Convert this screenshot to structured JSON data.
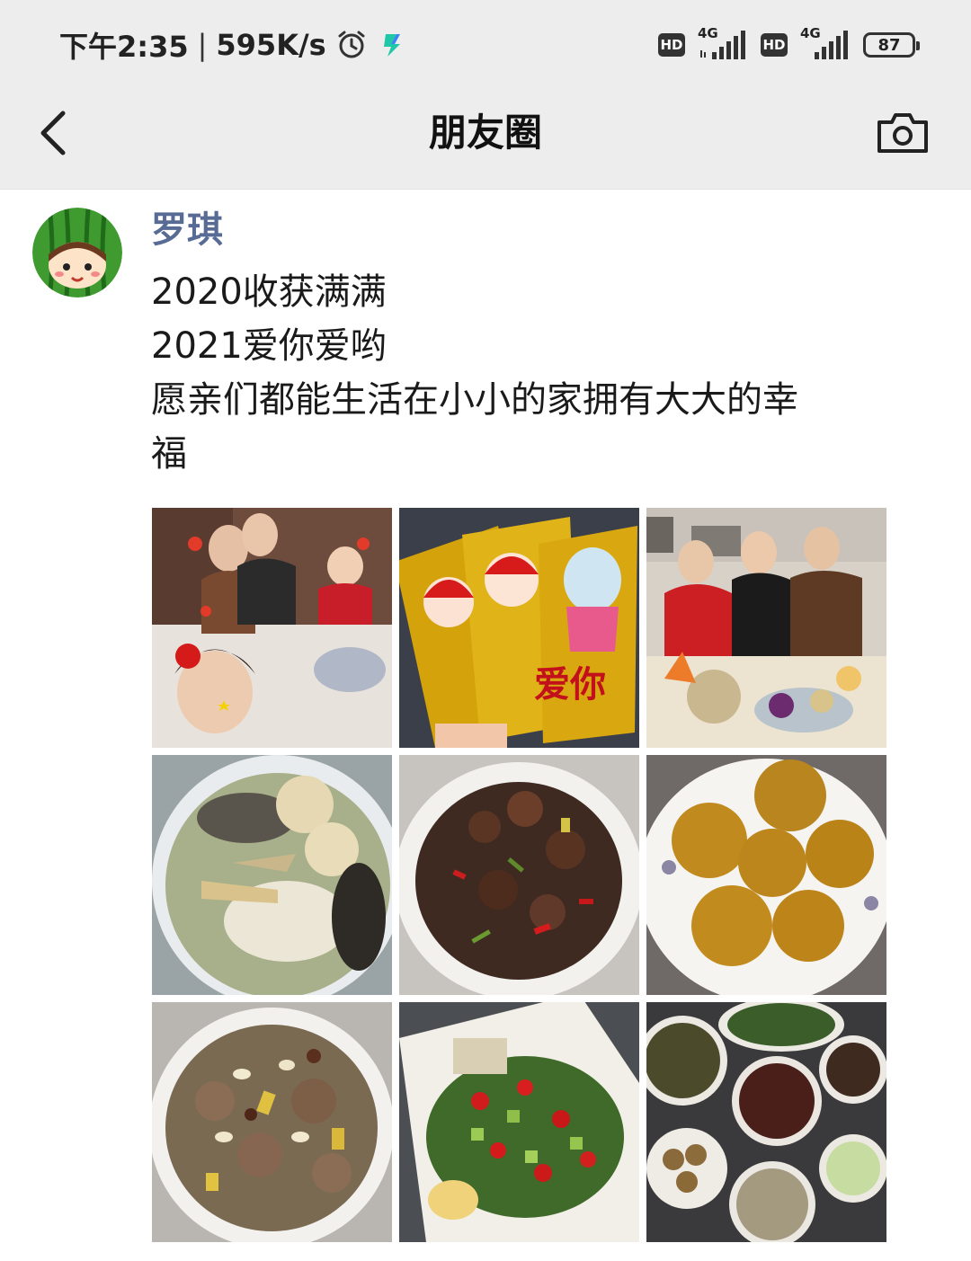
{
  "status_bar": {
    "time": "下午2:35",
    "separator": "|",
    "network_speed": "595K/s",
    "hd_label": "HD",
    "network_type": "4G",
    "battery": "87",
    "icons": [
      "alarm-clock-icon",
      "app-notification-icon",
      "hd-badge",
      "signal-icon",
      "battery-icon"
    ]
  },
  "nav": {
    "title": "朋友圈",
    "back_icon": "chevron-left-icon",
    "camera_icon": "camera-icon"
  },
  "post": {
    "author": "罗琪",
    "avatar_icon": "watermelon-avatar",
    "text_lines": [
      "2020收获满满",
      "2021爱你爱哟",
      "愿亲们都能生活在小小的家拥有大大的幸",
      "福"
    ],
    "photos": [
      {
        "subject": "family-selfie"
      },
      {
        "subject": "red-envelopes"
      },
      {
        "subject": "children-at-table"
      },
      {
        "subject": "chicken-soup-dish"
      },
      {
        "subject": "stir-fried-meat-dish"
      },
      {
        "subject": "golden-buns-dish"
      },
      {
        "subject": "braised-meat-dish"
      },
      {
        "subject": "pepper-vegetable-dish"
      },
      {
        "subject": "table-of-dishes"
      }
    ],
    "red_envelope_text": "爱你"
  }
}
